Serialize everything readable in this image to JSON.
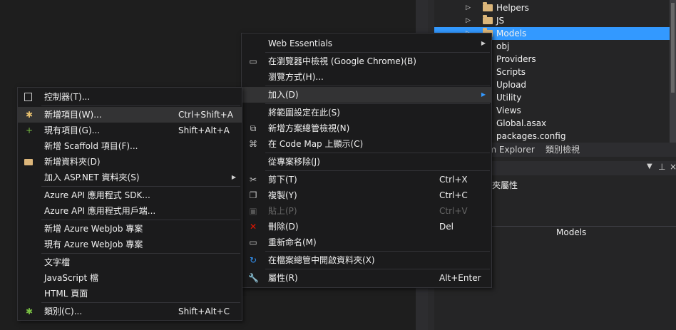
{
  "solution_explorer": {
    "items": [
      {
        "label": "Helpers",
        "type": "folder",
        "expandable": true
      },
      {
        "label": "JS",
        "type": "folder",
        "expandable": true
      },
      {
        "label": "Models",
        "type": "folder",
        "expandable": true,
        "selected": true
      },
      {
        "label": "obj",
        "type": "folder"
      },
      {
        "label": "Providers",
        "type": "folder"
      },
      {
        "label": "Scripts",
        "type": "folder"
      },
      {
        "label": "Upload",
        "type": "folder"
      },
      {
        "label": "Utility",
        "type": "folder"
      },
      {
        "label": "Views",
        "type": "folder"
      },
      {
        "label": "Global.asax",
        "type": "file"
      },
      {
        "label": "packages.config",
        "type": "file"
      }
    ],
    "tabs": {
      "team_explorer": "am Explorer",
      "class_view": "類別檢視"
    }
  },
  "properties": {
    "pin_icon": "pin-icon",
    "title": "夾屬性",
    "value": "Models"
  },
  "context_menu": {
    "items": [
      {
        "label": "Web Essentials",
        "submenu": true
      },
      {
        "label": "在瀏覽器中檢視 (Google Chrome)(B)",
        "icon": "browser-icon"
      },
      {
        "label": "瀏覽方式(H)..."
      },
      {
        "label": "加入(D)",
        "submenu": true,
        "highlighted": true
      },
      {
        "label": "將範圍設定在此(S)"
      },
      {
        "label": "新增方案總管檢視(N)",
        "icon": "new-view-icon"
      },
      {
        "label": "在 Code Map 上顯示(C)",
        "icon": "code-map-icon"
      },
      {
        "label": "從專案移除(J)"
      },
      {
        "label": "剪下(T)",
        "shortcut": "Ctrl+X",
        "icon": "scissors-icon"
      },
      {
        "label": "複製(Y)",
        "shortcut": "Ctrl+C",
        "icon": "copy-icon"
      },
      {
        "label": "貼上(P)",
        "shortcut": "Ctrl+V",
        "icon": "paste-icon",
        "disabled": true
      },
      {
        "label": "刪除(D)",
        "shortcut": "Del",
        "icon": "delete-icon"
      },
      {
        "label": "重新命名(M)",
        "icon": "rename-icon"
      },
      {
        "label": "在檔案總管中開啟資料夾(X)",
        "icon": "refresh-icon"
      },
      {
        "label": "屬性(R)",
        "shortcut": "Alt+Enter",
        "icon": "wrench-icon"
      }
    ]
  },
  "add_submenu": {
    "items": [
      {
        "label": "控制器(T)...",
        "icon": "controller-icon"
      },
      {
        "label": "新增項目(W)...",
        "shortcut": "Ctrl+Shift+A",
        "icon": "new-item-icon",
        "highlighted": true
      },
      {
        "label": "現有項目(G)...",
        "shortcut": "Shift+Alt+A",
        "icon": "existing-item-icon"
      },
      {
        "label": "新增 Scaffold 項目(F)..."
      },
      {
        "label": "新增資料夾(D)",
        "icon": "new-folder-icon"
      },
      {
        "label": "加入 ASP.NET 資料夾(S)",
        "submenu": true
      },
      {
        "label": "Azure API 應用程式 SDK..."
      },
      {
        "label": "Azure API 應用程式用戶端..."
      },
      {
        "label": "新增 Azure WebJob 專案"
      },
      {
        "label": "現有 Azure WebJob 專案"
      },
      {
        "label": "文字檔"
      },
      {
        "label": "JavaScript 檔"
      },
      {
        "label": "HTML 頁面"
      },
      {
        "label": "類別(C)...",
        "shortcut": "Shift+Alt+C",
        "icon": "class-icon"
      }
    ]
  }
}
